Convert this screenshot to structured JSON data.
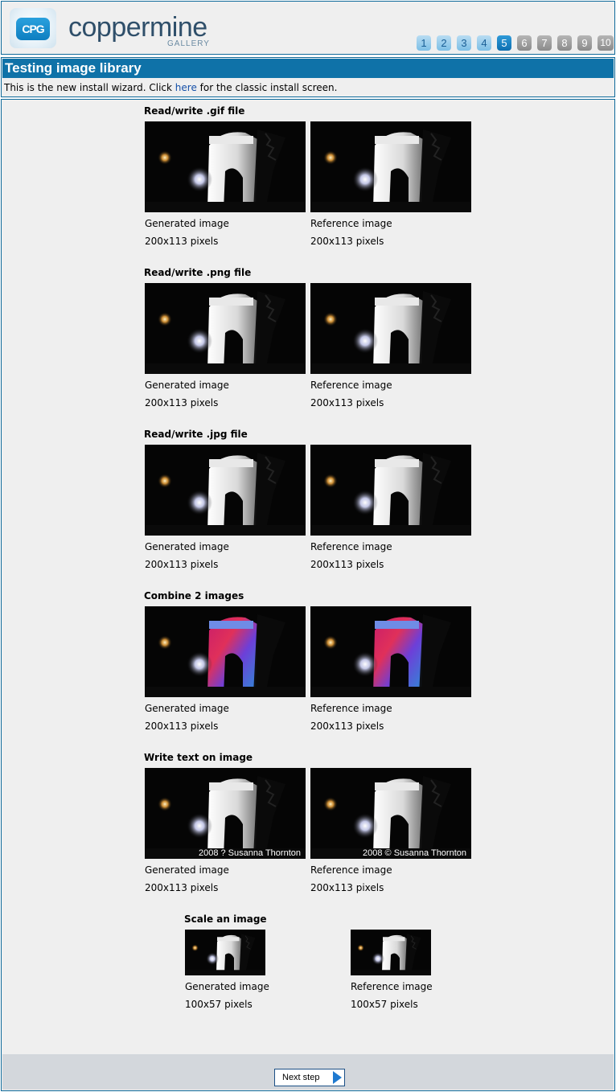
{
  "header": {
    "logo_badge": "CPG",
    "logo_word": "coppermine",
    "logo_sub": "GALLERY",
    "steps": [
      "1",
      "2",
      "3",
      "4",
      "5",
      "6",
      "7",
      "8",
      "9",
      "10"
    ],
    "current_step": 5
  },
  "title": "Testing image library",
  "intro": {
    "before": "This is the new install wizard. Click ",
    "link": "here",
    "after": " for the classic install screen."
  },
  "tests": [
    {
      "title": "Read/write .gif file",
      "generated_label": "Generated image",
      "reference_label": "Reference image",
      "generated_size": "200x113 pixels",
      "reference_size": "200x113 pixels"
    },
    {
      "title": "Read/write .png file",
      "generated_label": "Generated image",
      "reference_label": "Reference image",
      "generated_size": "200x113 pixels",
      "reference_size": "200x113 pixels"
    },
    {
      "title": "Read/write .jpg file",
      "generated_label": "Generated image",
      "reference_label": "Reference image",
      "generated_size": "200x113 pixels",
      "reference_size": "200x113 pixels"
    },
    {
      "title": "Combine 2 images",
      "generated_label": "Generated image",
      "reference_label": "Reference image",
      "generated_size": "200x113 pixels",
      "reference_size": "200x113 pixels"
    },
    {
      "title": "Write text on image",
      "generated_label": "Generated image",
      "reference_label": "Reference image",
      "generated_size": "200x113 pixels",
      "reference_size": "200x113 pixels",
      "generated_watermark": "2008 ? Susanna Thornton",
      "reference_watermark": "2008 © Susanna Thornton"
    },
    {
      "title": "Scale an image",
      "generated_label": "Generated image",
      "reference_label": "Reference image",
      "generated_size": "100x57 pixels",
      "reference_size": "100x57 pixels"
    }
  ],
  "footer": {
    "next_label": "Next step"
  }
}
